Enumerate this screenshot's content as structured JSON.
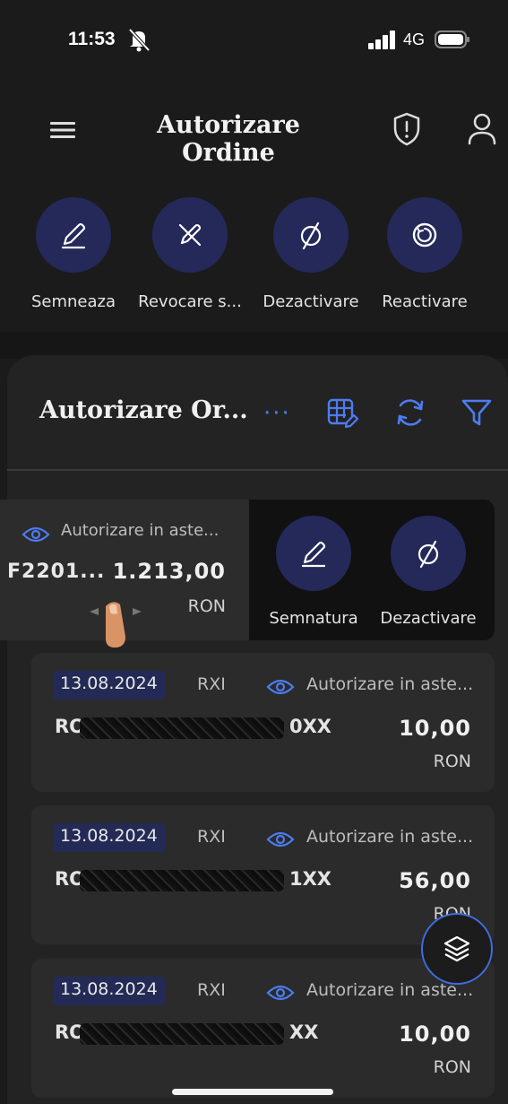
{
  "status_bar": {
    "time": "11:53",
    "network": "4G"
  },
  "header": {
    "title": "Autorizare Ordine"
  },
  "quick_actions": [
    {
      "label": "Semneaza",
      "icon": "pen-icon"
    },
    {
      "label": "Revocare s...",
      "icon": "pen-cancel-icon"
    },
    {
      "label": "Dezactivare",
      "icon": "slashed-circle-icon"
    },
    {
      "label": "Reactivare",
      "icon": "reactivate-icon"
    }
  ],
  "panel": {
    "title": "Autorizare Or...",
    "more": "···"
  },
  "swiped_row": {
    "status": "Autorizare in aste...",
    "reference": "F2201...",
    "amount": "1.213,00",
    "currency": "RON",
    "actions": [
      {
        "label": "Semnatura",
        "icon": "pen-icon"
      },
      {
        "label": "Dezactivare",
        "icon": "slashed-circle-icon"
      }
    ]
  },
  "orders": [
    {
      "date": "13.08.2024",
      "type": "RXI",
      "status": "Autorizare in aste...",
      "iban_prefix": "RO",
      "iban_suffix": "0XX",
      "amount": "10,00",
      "currency": "RON"
    },
    {
      "date": "13.08.2024",
      "type": "RXI",
      "status": "Autorizare in aste...",
      "iban_prefix": "RO",
      "iban_suffix": "1XX",
      "amount": "56,00",
      "currency": "RON"
    },
    {
      "date": "13.08.2024",
      "type": "RXI",
      "status": "Autorizare in aste...",
      "iban_prefix": "RO",
      "iban_suffix": "XX",
      "amount": "10,00",
      "currency": "RON"
    }
  ],
  "colors": {
    "background": "#1b1b1b",
    "accent": "#4d7cf2",
    "action_circle": "#24295a",
    "date_badge": "#232a55"
  }
}
